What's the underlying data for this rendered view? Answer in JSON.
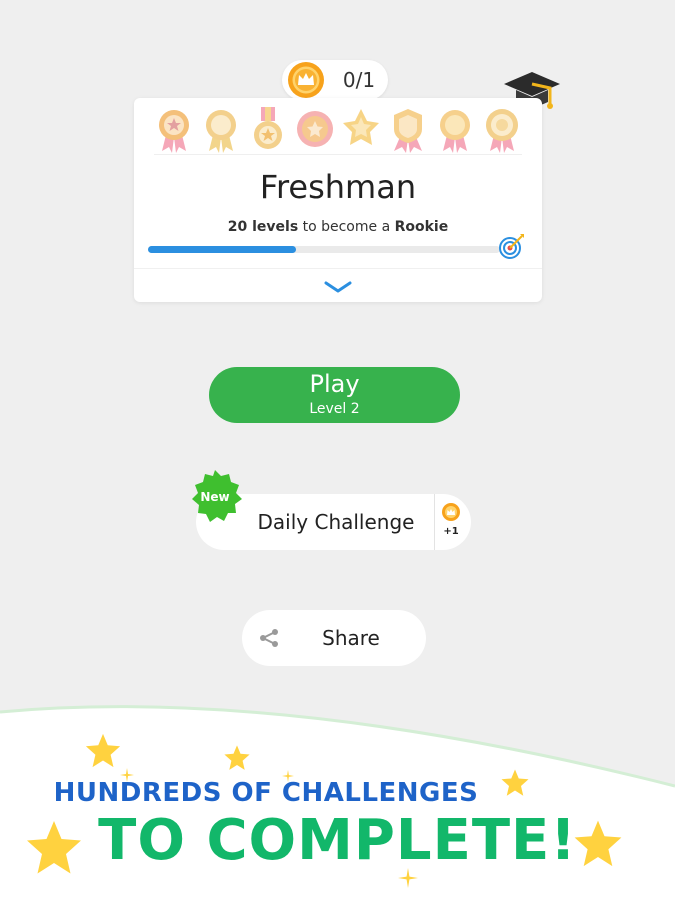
{
  "header": {
    "coins": "0/1",
    "icons": [
      "crown-coin-icon",
      "graduation-cap-icon"
    ]
  },
  "rank_card": {
    "badge_icons": [
      "medal-1-icon",
      "medal-2-icon",
      "medal-3-icon",
      "medal-4-icon",
      "medal-5-icon",
      "medal-6-icon",
      "medal-7-icon",
      "medal-8-icon"
    ],
    "title": "Freshman",
    "subtitle_count": "20 levels",
    "subtitle_mid": " to become a ",
    "subtitle_rank": "Rookie",
    "progress": 0.42,
    "progress_color": "#2b8fe0"
  },
  "play_button": {
    "label": "Play",
    "level": "Level 2",
    "color": "#37b24d"
  },
  "daily_challenge": {
    "badge": "New",
    "label": "Daily Challenge",
    "reward": "+1"
  },
  "share": {
    "label": "Share"
  },
  "promo": {
    "line1": "HUNDREDS OF CHALLENGES",
    "line2": "TO COMPLETE!",
    "line1_color": "#1e63c8",
    "line2_color": "#12b76a",
    "star_color": "#ffd23f"
  }
}
